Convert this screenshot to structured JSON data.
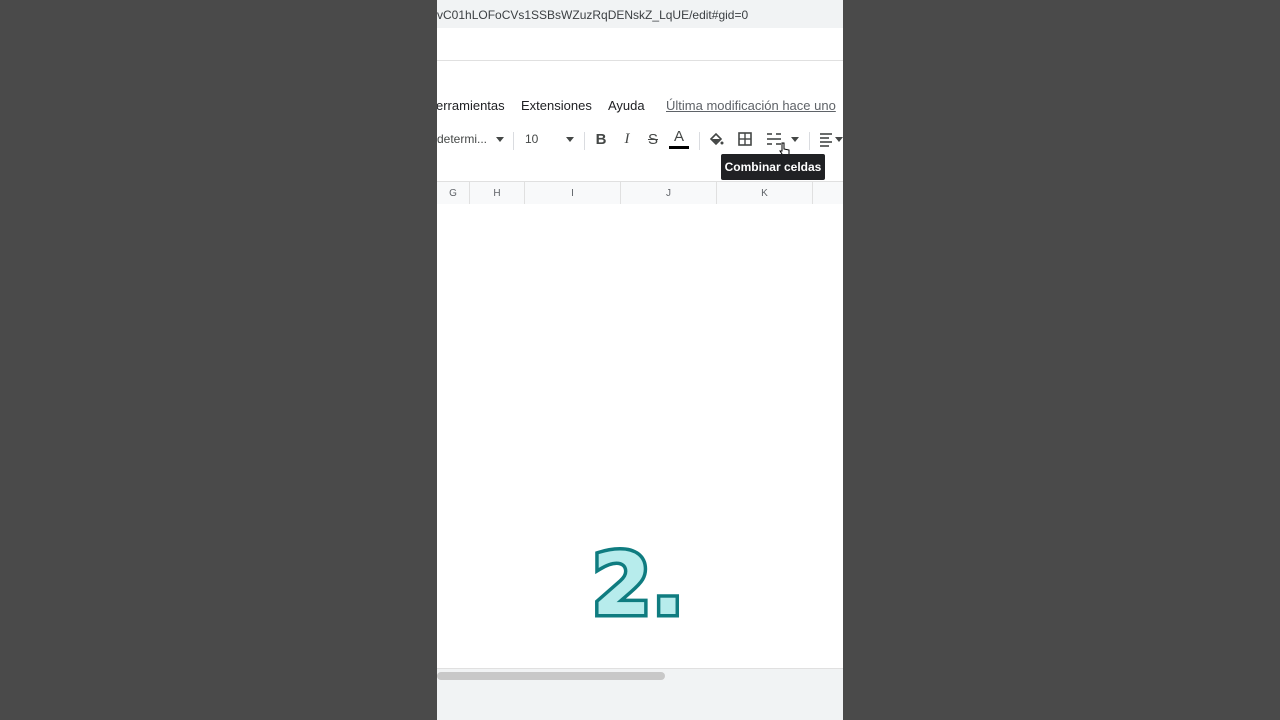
{
  "browser": {
    "url": "vC01hLOFoCVs1SSBsWZuzRqDENskZ_LqUE/edit#gid=0"
  },
  "menubar": {
    "items": [
      "erramientas",
      "Extensiones",
      "Ayuda"
    ],
    "last_modified": "Última modificación hace uno"
  },
  "toolbar": {
    "font": "determi...",
    "font_size": "10",
    "bold_icon": "B",
    "italic_icon": "I",
    "strike_icon": "S",
    "text_color_icon": "A",
    "tooltip": "Combinar celdas"
  },
  "columns": [
    "G",
    "H",
    "I",
    "J",
    "K"
  ],
  "overlay": {
    "step_label": "2."
  },
  "colors": {
    "step_fill": "#b7ecec",
    "step_outline": "#0f7c80",
    "background": "#4a4a4a"
  }
}
